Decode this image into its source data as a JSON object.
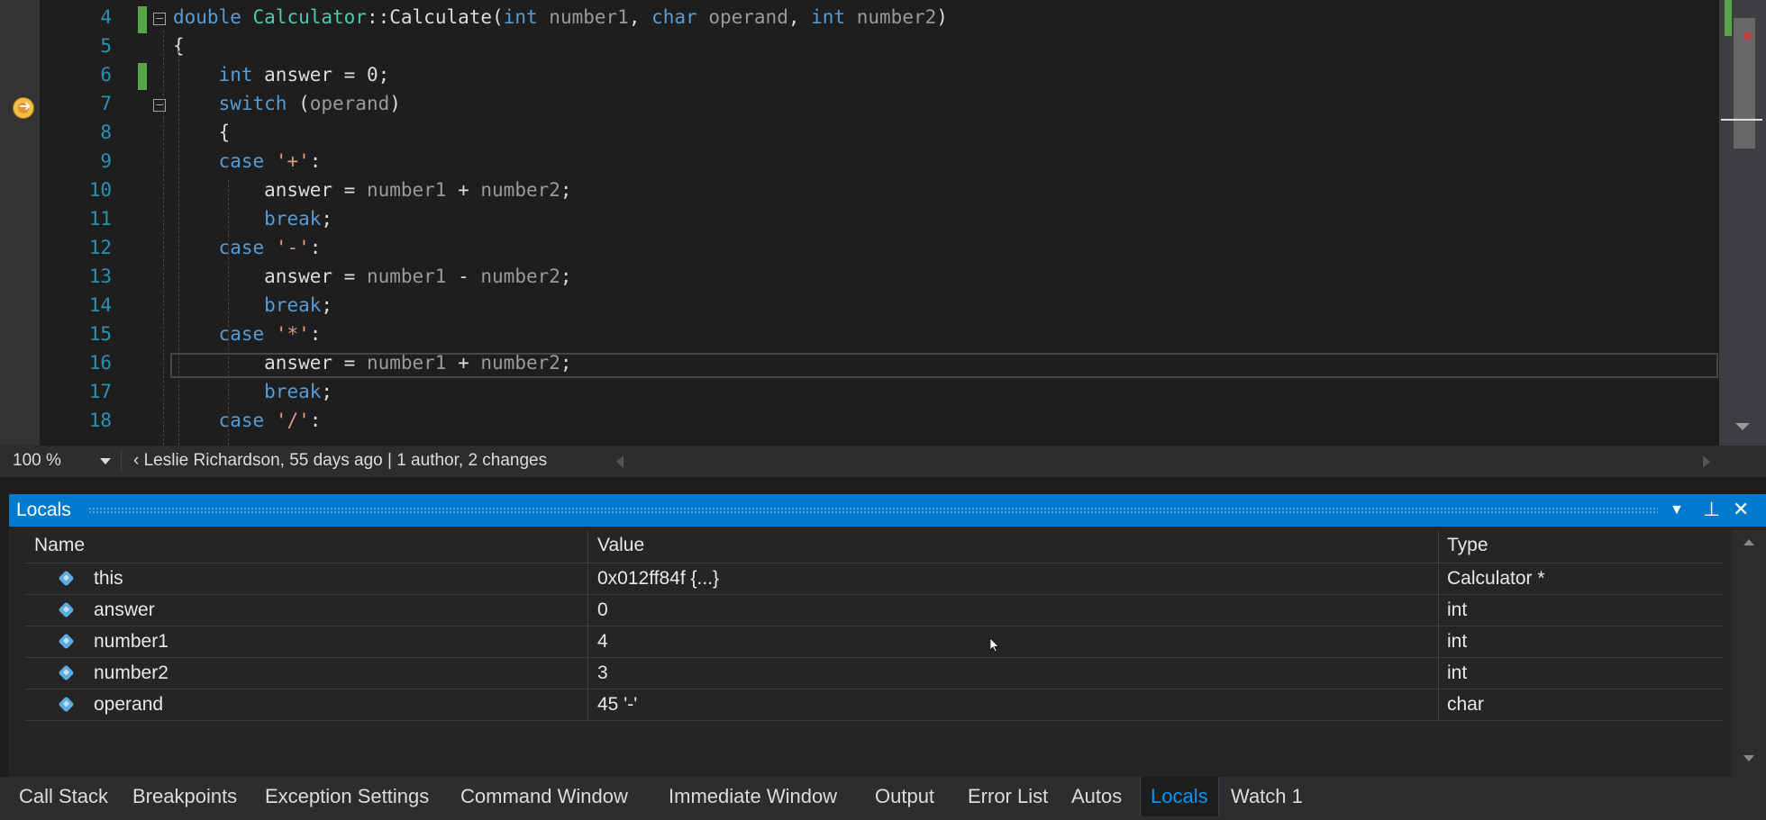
{
  "editor": {
    "line_numbers": [
      "4",
      "5",
      "6",
      "7",
      "8",
      "9",
      "10",
      "11",
      "12",
      "13",
      "14",
      "15",
      "16",
      "17",
      "18"
    ],
    "lines": [
      {
        "tokens": [
          [
            "kw",
            "double"
          ],
          [
            "id",
            " "
          ],
          [
            "cls",
            "Calculator"
          ],
          [
            "id",
            "::"
          ],
          [
            "id",
            "Calculate"
          ],
          [
            "id",
            "("
          ],
          [
            "kw",
            "int"
          ],
          [
            "id",
            " "
          ],
          [
            "param",
            "number1"
          ],
          [
            "id",
            ", "
          ],
          [
            "kw",
            "char"
          ],
          [
            "id",
            " "
          ],
          [
            "param",
            "operand"
          ],
          [
            "id",
            ", "
          ],
          [
            "kw",
            "int"
          ],
          [
            "id",
            " "
          ],
          [
            "param",
            "number2"
          ],
          [
            "id",
            ")"
          ]
        ]
      },
      {
        "tokens": [
          [
            "id",
            "{"
          ]
        ]
      },
      {
        "tokens": [
          [
            "id",
            "    "
          ],
          [
            "kw",
            "int"
          ],
          [
            "id",
            " answer = 0;"
          ]
        ]
      },
      {
        "tokens": [
          [
            "id",
            "    "
          ],
          [
            "kw",
            "switch"
          ],
          [
            "id",
            " ("
          ],
          [
            "param",
            "operand"
          ],
          [
            "id",
            ")"
          ]
        ]
      },
      {
        "tokens": [
          [
            "id",
            "    {"
          ]
        ]
      },
      {
        "tokens": [
          [
            "id",
            "    "
          ],
          [
            "kw",
            "case"
          ],
          [
            "id",
            " "
          ],
          [
            "str",
            "'+'"
          ],
          [
            "id",
            ":"
          ]
        ]
      },
      {
        "tokens": [
          [
            "id",
            "        answer = "
          ],
          [
            "param",
            "number1"
          ],
          [
            "id",
            " + "
          ],
          [
            "param",
            "number2"
          ],
          [
            "id",
            ";"
          ]
        ]
      },
      {
        "tokens": [
          [
            "id",
            "        "
          ],
          [
            "kw",
            "break"
          ],
          [
            "id",
            ";"
          ]
        ]
      },
      {
        "tokens": [
          [
            "id",
            "    "
          ],
          [
            "kw",
            "case"
          ],
          [
            "id",
            " "
          ],
          [
            "str",
            "'-'"
          ],
          [
            "id",
            ":"
          ]
        ]
      },
      {
        "tokens": [
          [
            "id",
            "        answer = "
          ],
          [
            "param",
            "number1"
          ],
          [
            "id",
            " - "
          ],
          [
            "param",
            "number2"
          ],
          [
            "id",
            ";"
          ]
        ]
      },
      {
        "tokens": [
          [
            "id",
            "        "
          ],
          [
            "kw",
            "break"
          ],
          [
            "id",
            ";"
          ]
        ]
      },
      {
        "tokens": [
          [
            "id",
            "    "
          ],
          [
            "kw",
            "case"
          ],
          [
            "id",
            " "
          ],
          [
            "str",
            "'*'"
          ],
          [
            "id",
            ":"
          ]
        ]
      },
      {
        "tokens": [
          [
            "id",
            "        answer = "
          ],
          [
            "param",
            "number1"
          ],
          [
            "id",
            " + "
          ],
          [
            "param",
            "number2"
          ],
          [
            "id",
            ";"
          ]
        ]
      },
      {
        "tokens": [
          [
            "id",
            "        "
          ],
          [
            "kw",
            "break"
          ],
          [
            "id",
            ";"
          ]
        ]
      },
      {
        "tokens": [
          [
            "id",
            "    "
          ],
          [
            "kw",
            "case"
          ],
          [
            "id",
            " "
          ],
          [
            "str",
            "'/'"
          ],
          [
            "id",
            ":"
          ]
        ]
      }
    ],
    "zoom_level": "100 %",
    "codelens": "Leslie Richardson, 55 days ago | 1 author, 2 changes"
  },
  "locals": {
    "title": "Locals",
    "columns": {
      "name": "Name",
      "value": "Value",
      "type": "Type"
    },
    "rows": [
      {
        "name": "this",
        "value": "0x012ff84f {...}",
        "type": "Calculator *"
      },
      {
        "name": "answer",
        "value": "0",
        "type": "int"
      },
      {
        "name": "number1",
        "value": "4",
        "type": "int"
      },
      {
        "name": "number2",
        "value": "3",
        "type": "int"
      },
      {
        "name": "operand",
        "value": "45 '-'",
        "type": "char"
      }
    ]
  },
  "tabs": [
    "Call Stack",
    "Breakpoints",
    "Exception Settings",
    "Command Window",
    "Immediate Window",
    "Output",
    "Error List",
    "Autos",
    "Locals",
    "Watch 1"
  ],
  "active_tab": "Locals",
  "colors": {
    "accent": "#007acc",
    "keyword": "#569cd6",
    "line_number": "#2b91af",
    "change_marker": "#57a64a",
    "active_tab_text": "#0097fb"
  }
}
